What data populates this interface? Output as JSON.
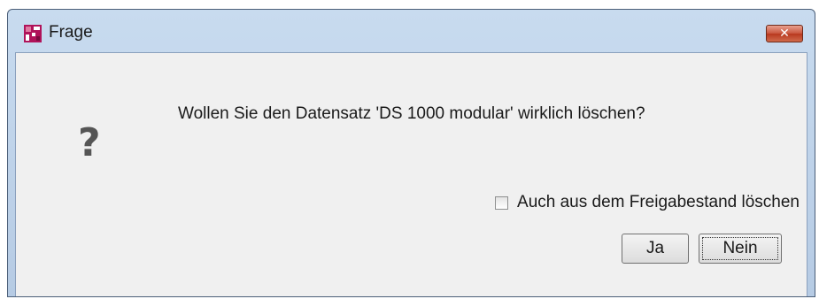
{
  "window": {
    "title": "Frage",
    "close_symbol": "✕",
    "icon": "app-logo-icon"
  },
  "dialog": {
    "icon": "question-icon",
    "icon_glyph": "?",
    "message": "Wollen Sie den Datensatz 'DS 1000 modular' wirklich löschen?",
    "checkbox_label": "Auch aus dem Freigabestand löschen",
    "checkbox_checked": false,
    "buttons": {
      "yes_label": "Ja",
      "no_label": "Nein"
    }
  },
  "colors": {
    "app_icon": "#b0135a",
    "close_button": "#c8543c",
    "titlebar": "#c8dbef"
  }
}
